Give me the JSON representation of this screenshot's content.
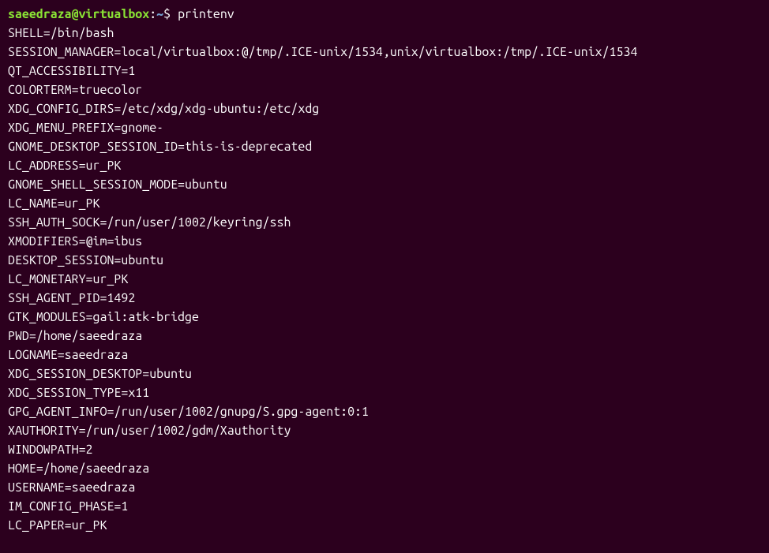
{
  "prompt": {
    "user_host": "saeedraza@virtualbox",
    "separator": ":",
    "path": "~",
    "symbol": "$ "
  },
  "command": "printenv",
  "env_lines": [
    "SHELL=/bin/bash",
    "SESSION_MANAGER=local/virtualbox:@/tmp/.ICE-unix/1534,unix/virtualbox:/tmp/.ICE-unix/1534",
    "QT_ACCESSIBILITY=1",
    "COLORTERM=truecolor",
    "XDG_CONFIG_DIRS=/etc/xdg/xdg-ubuntu:/etc/xdg",
    "XDG_MENU_PREFIX=gnome-",
    "GNOME_DESKTOP_SESSION_ID=this-is-deprecated",
    "LC_ADDRESS=ur_PK",
    "GNOME_SHELL_SESSION_MODE=ubuntu",
    "LC_NAME=ur_PK",
    "SSH_AUTH_SOCK=/run/user/1002/keyring/ssh",
    "XMODIFIERS=@im=ibus",
    "DESKTOP_SESSION=ubuntu",
    "LC_MONETARY=ur_PK",
    "SSH_AGENT_PID=1492",
    "GTK_MODULES=gail:atk-bridge",
    "PWD=/home/saeedraza",
    "LOGNAME=saeedraza",
    "XDG_SESSION_DESKTOP=ubuntu",
    "XDG_SESSION_TYPE=x11",
    "GPG_AGENT_INFO=/run/user/1002/gnupg/S.gpg-agent:0:1",
    "XAUTHORITY=/run/user/1002/gdm/Xauthority",
    "WINDOWPATH=2",
    "HOME=/home/saeedraza",
    "USERNAME=saeedraza",
    "IM_CONFIG_PHASE=1",
    "LC_PAPER=ur_PK"
  ]
}
